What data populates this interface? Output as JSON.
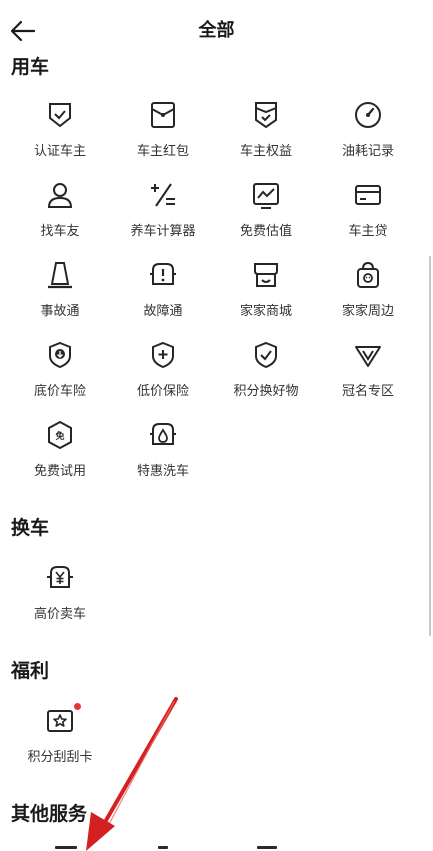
{
  "header": {
    "title": "全部",
    "back_icon": "arrow-left-icon"
  },
  "sections": [
    {
      "title": "用车",
      "items": [
        {
          "label": "认证车主",
          "icon": "shield-check-icon"
        },
        {
          "label": "车主红包",
          "icon": "red-envelope-icon"
        },
        {
          "label": "车主权益",
          "icon": "badge-check-icon"
        },
        {
          "label": "油耗记录",
          "icon": "gauge-icon"
        },
        {
          "label": "找车友",
          "icon": "user-icon"
        },
        {
          "label": "养车计算器",
          "icon": "calculator-icon"
        },
        {
          "label": "免费估值",
          "icon": "trend-chart-icon"
        },
        {
          "label": "车主贷",
          "icon": "card-icon"
        },
        {
          "label": "事故通",
          "icon": "traffic-cone-icon"
        },
        {
          "label": "故障通",
          "icon": "car-alert-icon"
        },
        {
          "label": "家家商城",
          "icon": "store-icon"
        },
        {
          "label": "家家周边",
          "icon": "shopping-bag-icon"
        },
        {
          "label": "底价车险",
          "icon": "shield-down-icon"
        },
        {
          "label": "低价保险",
          "icon": "shield-plus-icon"
        },
        {
          "label": "积分换好物",
          "icon": "shield-tick-icon"
        },
        {
          "label": "冠名专区",
          "icon": "v-badge-icon"
        },
        {
          "label": "免费试用",
          "icon": "free-badge-icon"
        },
        {
          "label": "特惠洗车",
          "icon": "car-wash-icon"
        }
      ]
    },
    {
      "title": "换车",
      "items": [
        {
          "label": "高价卖车",
          "icon": "car-yen-icon"
        }
      ]
    },
    {
      "title": "福利",
      "items": [
        {
          "label": "积分刮刮卡",
          "icon": "scratch-card-icon"
        }
      ]
    },
    {
      "title": "其他服务",
      "items": []
    }
  ],
  "colors": {
    "text": "#1f1f1f",
    "icon": "#262626",
    "notification_dot": "#e63333",
    "annotation_arrow": "#d42020"
  }
}
